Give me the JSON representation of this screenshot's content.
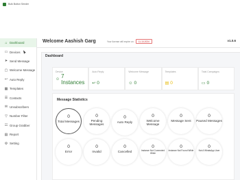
{
  "app": {
    "title": "Bulk Button Sender"
  },
  "sidebar": {
    "items": [
      {
        "label": "Dashboard",
        "icon": "home-icon",
        "glyph": "⌂",
        "active": true
      },
      {
        "label": "Devices",
        "icon": "monitor-icon",
        "glyph": "▭",
        "active": false
      },
      {
        "label": "Send Message",
        "icon": "send-icon",
        "glyph": "➤",
        "active": false
      },
      {
        "label": "Welcome Message",
        "icon": "chat-icon",
        "glyph": "▢",
        "active": false
      },
      {
        "label": "Auto Reply",
        "icon": "reply-icon",
        "glyph": "↩",
        "active": false
      },
      {
        "label": "Templates",
        "icon": "template-icon",
        "glyph": "▦",
        "active": false
      },
      {
        "label": "Contacts",
        "icon": "contacts-icon",
        "glyph": "☰",
        "active": false
      },
      {
        "label": "Unsubscribers",
        "icon": "unsubscribe-icon",
        "glyph": "✉",
        "active": false
      },
      {
        "label": "Number Filter",
        "icon": "filter-icon",
        "glyph": "▽",
        "active": false
      },
      {
        "label": "Group Grabber",
        "icon": "group-icon",
        "glyph": "☷",
        "active": false
      },
      {
        "label": "Report",
        "icon": "report-icon",
        "glyph": "▤",
        "active": false
      },
      {
        "label": "Setting",
        "icon": "gear-icon",
        "glyph": "⚙",
        "active": false
      }
    ]
  },
  "header": {
    "welcome": "Welcome Aashish Garg",
    "expiry_text": "Your license will expire on",
    "expiry_date": "11-10-2024",
    "version": "v1.0.6"
  },
  "dashboard": {
    "title": "Dashboard",
    "stats": [
      {
        "label": "Device",
        "value": "7 Instances",
        "glyph": "☺"
      },
      {
        "label": "Auto Reply",
        "value": "0",
        "glyph": "↩"
      },
      {
        "label": "Welcome Message",
        "value": "0",
        "glyph": "☺"
      },
      {
        "label": "Templates",
        "value": "0",
        "glyph": "▤"
      },
      {
        "label": "Total Campaigns",
        "value": "0",
        "glyph": "▭"
      }
    ],
    "message_stats": {
      "title": "Message Statistics",
      "items": [
        {
          "count": "0",
          "label": "Total Messages"
        },
        {
          "count": "0",
          "label": "Pending Messages"
        },
        {
          "count": "0",
          "label": "Auto Reply"
        },
        {
          "count": "0",
          "label": "Welcome Message"
        },
        {
          "count": "0",
          "label": "Message Sent"
        },
        {
          "count": "0",
          "label": "Paused Messages"
        },
        {
          "count": "0",
          "label": "Error"
        },
        {
          "count": "0",
          "label": "Invalid"
        },
        {
          "count": "0",
          "label": "Cancelled"
        },
        {
          "count": "0",
          "label": "Instance Not Connected While"
        },
        {
          "count": "0",
          "label": "Instance Not Found While"
        },
        {
          "count": "0",
          "label": "Not A WhatsApp User"
        }
      ]
    }
  }
}
